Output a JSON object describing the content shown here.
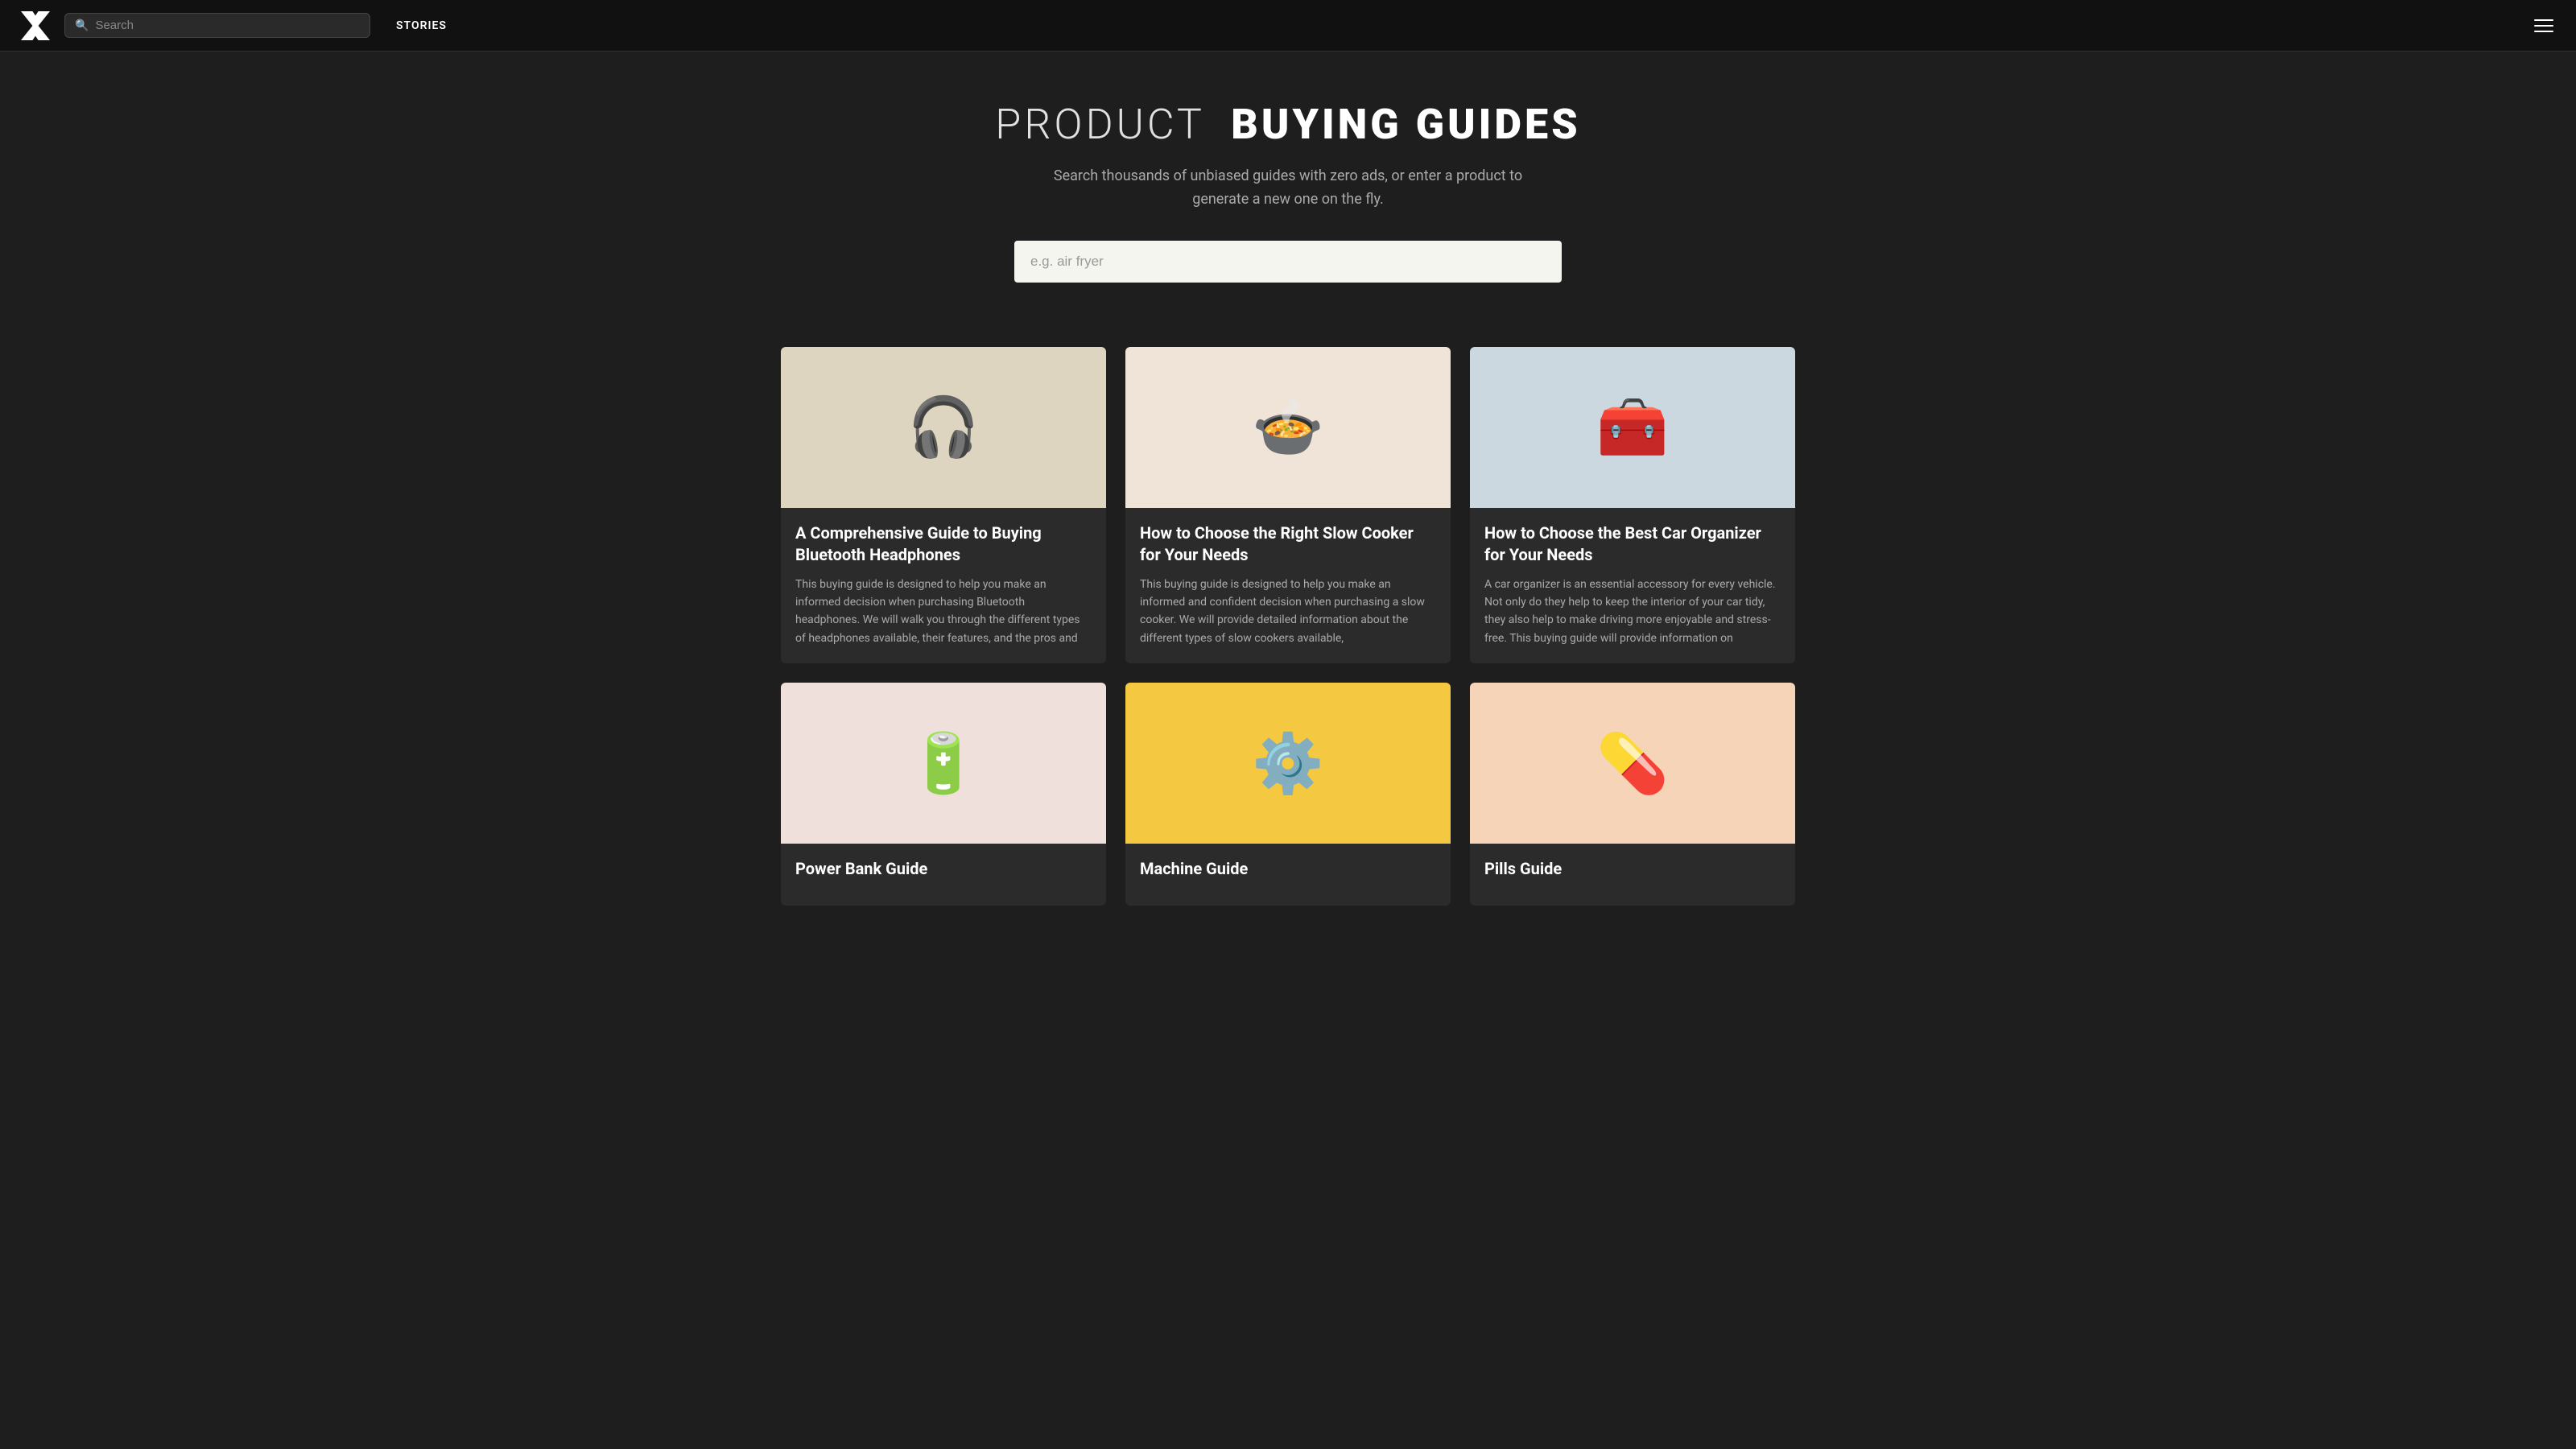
{
  "navbar": {
    "logo_alt": "X Logo",
    "search_placeholder": "Search",
    "stories_label": "STORIES",
    "menu_icon": "hamburger-menu"
  },
  "hero": {
    "title_light": "PRODUCT",
    "title_bold": "BUYING GUIDES",
    "subtitle": "Search thousands of unbiased guides with zero ads, or enter a product to generate a new one on the fly.",
    "search_placeholder": "e.g. air fryer"
  },
  "cards": [
    {
      "id": "headphones",
      "title": "A Comprehensive Guide to Buying Bluetooth Headphones",
      "description": "This buying guide is designed to help you make an informed decision when purchasing Bluetooth headphones. We will walk you through the different types of headphones available, their features, and the pros and",
      "image_bg": "#ddd5c0",
      "image_emoji": "🎧",
      "image_label": "bluetooth-headphones-illustration"
    },
    {
      "id": "slow-cooker",
      "title": "How to Choose the Right Slow Cooker for Your Needs",
      "description": "This buying guide is designed to help you make an informed and confident decision when purchasing a slow cooker. We will provide detailed information about the different types of slow cookers available,",
      "image_bg": "#f0e4d8",
      "image_emoji": "🍲",
      "image_label": "slow-cooker-illustration"
    },
    {
      "id": "car-organizer",
      "title": "How to Choose the Best Car Organizer for Your Needs",
      "description": "A car organizer is an essential accessory for every vehicle. Not only do they help to keep the interior of your car tidy, they also help to make driving more enjoyable and stress-free. This buying guide will provide information on",
      "image_bg": "#ccd8e0",
      "image_emoji": "🧰",
      "image_label": "car-organizer-illustration"
    },
    {
      "id": "power-bank",
      "title": "Power Bank Guide",
      "description": "",
      "image_bg": "#f0e0dc",
      "image_emoji": "🔋",
      "image_label": "power-bank-illustration"
    },
    {
      "id": "machine",
      "title": "Machine Guide",
      "description": "",
      "image_bg": "#f5c842",
      "image_emoji": "⚙️",
      "image_label": "machine-illustration"
    },
    {
      "id": "pills",
      "title": "Pills Guide",
      "description": "",
      "image_bg": "#f5d4b8",
      "image_emoji": "💊",
      "image_label": "pills-illustration"
    }
  ],
  "colors": {
    "bg": "#1e1e1e",
    "navbar_bg": "#111111",
    "card_bg": "#2b2b2b",
    "accent": "#ffffff"
  }
}
